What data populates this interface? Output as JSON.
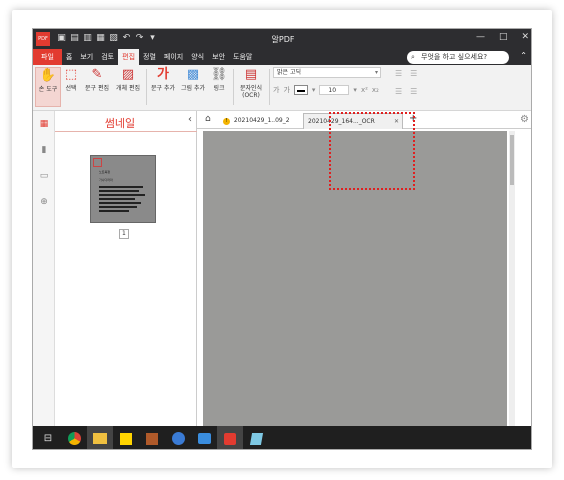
{
  "app": {
    "title": "알PDF",
    "logo_text": "PDF"
  },
  "window_controls": {
    "minimize": "—",
    "maximize": "□",
    "close": "✕"
  },
  "menu": {
    "file": "파일",
    "items": [
      "홈",
      "보기",
      "검토",
      "편집",
      "정렬",
      "페이지",
      "양식",
      "보안",
      "도움말"
    ],
    "active": "편집",
    "search_placeholder": "무엇을 하고 싶으세요?"
  },
  "ribbon": {
    "tools": [
      {
        "label": "손 도구",
        "icon": "hand-icon"
      },
      {
        "label": "선택",
        "icon": "select-icon"
      },
      {
        "label": "문구 편집",
        "icon": "edit-text-icon"
      },
      {
        "label": "개체 편집",
        "icon": "edit-object-icon"
      },
      {
        "label": "문구 추가",
        "icon": "add-text-icon"
      },
      {
        "label": "그림 추가",
        "icon": "add-image-icon"
      },
      {
        "label": "링크",
        "icon": "link-icon"
      },
      {
        "label": "문자인식 (OCR)",
        "icon": "ocr-icon"
      }
    ],
    "font_name": "맑은 고딕",
    "font_size": "10"
  },
  "thumbnail_panel": {
    "title": "썸네일",
    "page_number": "1"
  },
  "tabs": [
    {
      "label": "20210429_1..09_2",
      "warning": "!"
    },
    {
      "label": "20210429_164..._OCR"
    }
  ],
  "thumbnail_preview": {
    "heading": "노트북정",
    "subtitle": "가나다라마"
  }
}
